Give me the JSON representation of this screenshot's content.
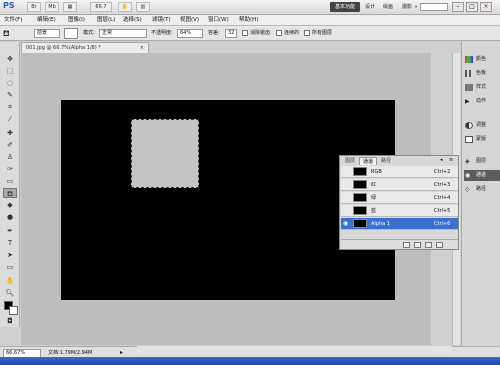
{
  "app": {
    "logo": "PS",
    "top_buttons": [
      "Br",
      "Mb"
    ],
    "zoom_value": "66.7",
    "workspaces": [
      "基本功能",
      "设计",
      "绘画",
      "摄影"
    ],
    "more_workspaces": "»"
  },
  "window_controls": {
    "minimize": "–",
    "restore": "□",
    "close": "×"
  },
  "menubar": [
    "文件(F)",
    "编辑(E)",
    "图像(I)",
    "图层(L)",
    "选择(S)",
    "滤镜(T)",
    "视图(V)",
    "窗口(W)",
    "帮助(H)"
  ],
  "options": {
    "preset": "前景",
    "mode_label": "模式:",
    "mode_value": "正常",
    "opacity_label": "不透明度:",
    "opacity_value": "64%",
    "tolerance_label": "容差:",
    "tolerance_value": "32",
    "antialias_label": "消除锯齿",
    "contiguous_label": "连续的",
    "all_layers_label": "所有图层"
  },
  "document": {
    "tab_title": "001.jpg @ 66.7%(Alpha 1/8) *",
    "tab_close": "×"
  },
  "status": {
    "zoom": "66.67%",
    "doc_info": "文档:1.79M/2.94M"
  },
  "dock": {
    "group1": [
      "颜色",
      "色板",
      "样式",
      "动作"
    ],
    "group2": [
      "调整",
      "蒙版"
    ],
    "group3": [
      "图层",
      "通道",
      "路径"
    ]
  },
  "channels_panel": {
    "tabs": [
      "图层",
      "通道",
      "路径"
    ],
    "rows": [
      {
        "name": "RGB",
        "shortcut": "Ctrl+2"
      },
      {
        "name": "红",
        "shortcut": "Ctrl+3"
      },
      {
        "name": "绿",
        "shortcut": "Ctrl+4"
      },
      {
        "name": "蓝",
        "shortcut": "Ctrl+5"
      },
      {
        "name": "Alpha 1",
        "shortcut": "Ctrl+6"
      }
    ]
  },
  "colors": {
    "canvas": "#000000",
    "selection_fill": "#c4c4c4",
    "selected_row": "#3c6fd0",
    "active_workspace": "#444444"
  }
}
